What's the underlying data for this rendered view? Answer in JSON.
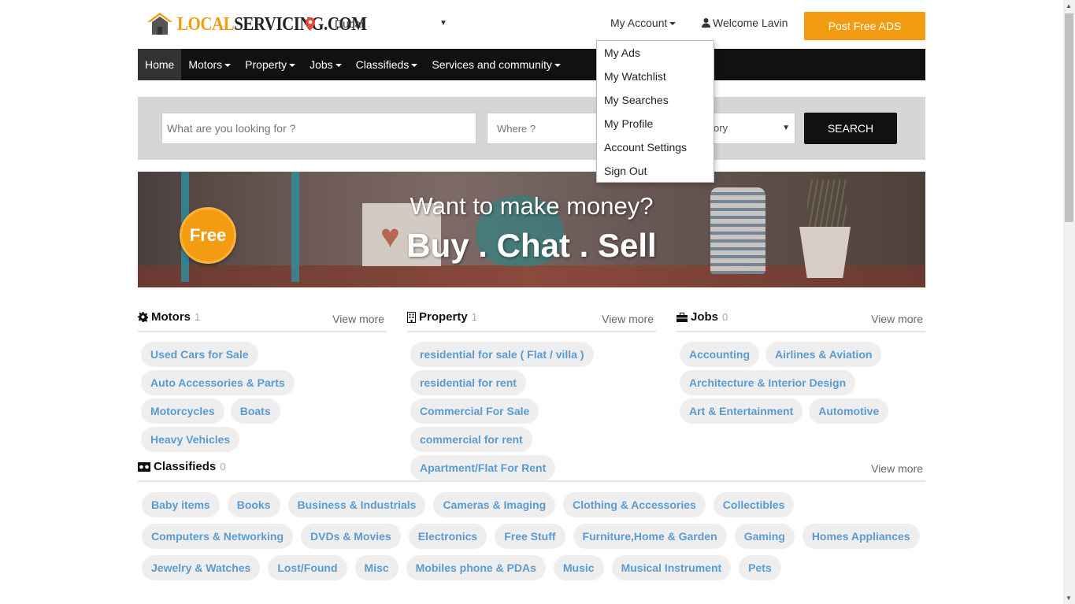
{
  "header": {
    "logo_part1": "LOCAL",
    "logo_part2": "SERVICING.COM",
    "city": "Dubai",
    "my_account": "My Account",
    "welcome": "Welcome Lavin",
    "post_ads": "Post Free ADS"
  },
  "nav": {
    "items": [
      "Home",
      "Motors",
      "Property",
      "Jobs",
      "Classifieds",
      "Services and community"
    ]
  },
  "search": {
    "what_placeholder": "What are you looking for ?",
    "where_placeholder": "Where ?",
    "category_visible": "ory",
    "button": "SEARCH"
  },
  "account_menu": {
    "items": [
      "My Ads",
      "My Watchlist",
      "My Searches",
      "My Profile",
      "Account Settings",
      "Sign Out"
    ]
  },
  "banner": {
    "badge": "Free",
    "line1": "Want to make money?",
    "line2": "Buy . Chat . Sell"
  },
  "sections": {
    "motors": {
      "title": "Motors",
      "count": "1",
      "view_more": "View more",
      "tags": [
        "Used Cars for Sale",
        "Auto Accessories & Parts",
        "Motorcycles",
        "Boats",
        "Heavy Vehicles"
      ]
    },
    "property": {
      "title": "Property",
      "count": "1",
      "view_more": "View more",
      "tags": [
        "residential for sale ( Flat / villa )",
        "residential for rent",
        "Commercial For Sale",
        "commercial for rent",
        "Apartment/Flat For Rent"
      ]
    },
    "jobs": {
      "title": "Jobs",
      "count": "0",
      "view_more": "View more",
      "tags": [
        "Accounting",
        "Airlines & Aviation",
        "Architecture & Interior Design",
        "Art & Entertainment",
        "Automotive"
      ]
    },
    "classifieds": {
      "title": "Classifieds",
      "count": "0",
      "view_more": "View more",
      "tags": [
        "Baby items",
        "Books",
        "Business & Industrials",
        "Cameras & Imaging",
        "Clothing & Accessories",
        "Collectibles",
        "Computers & Networking",
        "DVDs & Movies",
        "Electronics",
        "Free Stuff",
        "Furniture,Home & Garden",
        "Gaming",
        "Homes Appliances",
        "Jewelry & Watches",
        "Lost/Found",
        "Misc",
        "Mobiles phone & PDAs",
        "Music",
        "Musical Instrument",
        "Pets"
      ]
    }
  },
  "colors": {
    "accent": "#f39c12",
    "nav_bg": "#111111",
    "tag_text": "#5b9bd1",
    "tag_bg": "#eeeeee"
  }
}
